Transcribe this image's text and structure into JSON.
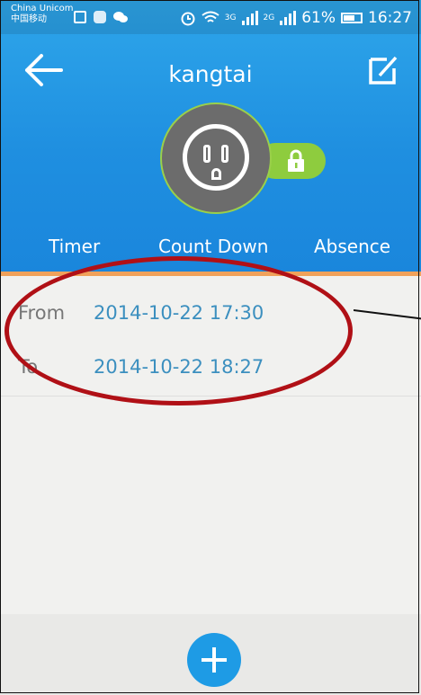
{
  "status_bar": {
    "carrier_line1": "China Unicom",
    "carrier_line2": "中国移动",
    "net1": "3G",
    "net2": "2G",
    "battery": "61%",
    "time": "16:27"
  },
  "header": {
    "title": "kangtai",
    "back_icon": "back-arrow-icon",
    "edit_icon": "edit-icon",
    "device_icon": "power-outlet-icon",
    "lock_icon": "lock-icon"
  },
  "tabs": [
    {
      "label": "Timer"
    },
    {
      "label": "Count Down"
    },
    {
      "label": "Absence"
    }
  ],
  "schedule": {
    "from_label": "From",
    "from_value": "2014-10-22 17:30",
    "to_label": "To",
    "to_value": "2014-10-22 18:27"
  },
  "footer": {
    "add_icon": "plus-icon"
  },
  "colors": {
    "header_blue": "#1f8fe0",
    "accent_orange": "#f0a15a",
    "lock_green": "#8ecc3e",
    "value_blue": "#3b8fbf",
    "annotation_red": "#b01016"
  }
}
